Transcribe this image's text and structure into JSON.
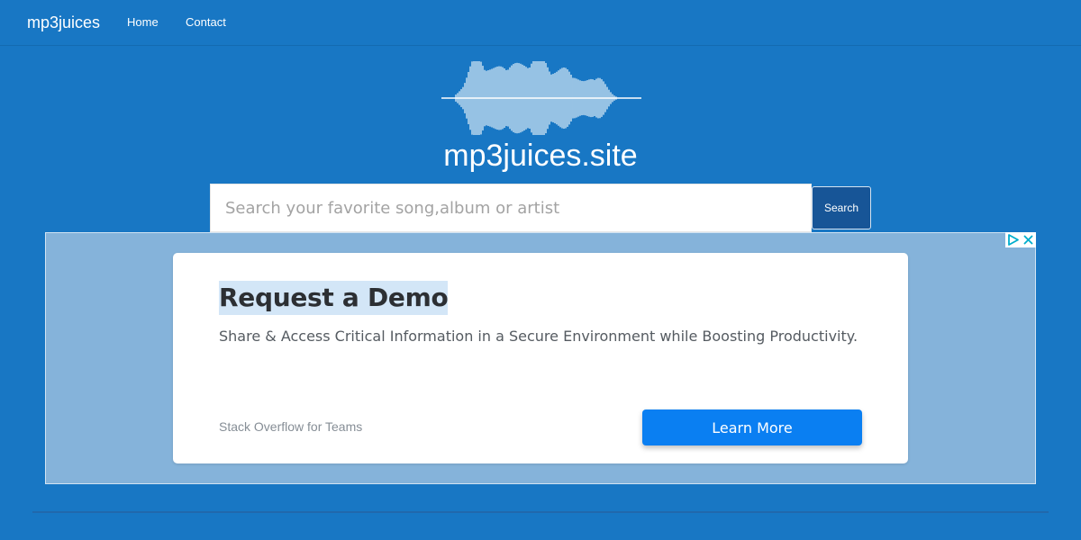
{
  "navbar": {
    "brand": "mp3juices",
    "links": [
      "Home",
      "Contact"
    ]
  },
  "hero": {
    "logo_icon": "sound-waveform-icon",
    "site_title": "mp3juices.site"
  },
  "search": {
    "placeholder": "Search your favorite song,album or artist",
    "value": "",
    "button_label": "Search"
  },
  "ad": {
    "headline": "Request a Demo",
    "description": "Share & Access Critical Information in a Secure Environment while Boosting Productivity.",
    "advertiser": "Stack Overflow for Teams",
    "cta_label": "Learn More",
    "adchoices_icon": "adchoices-icon",
    "close_icon": "close-icon"
  },
  "colors": {
    "page_background": "#1877c4",
    "search_button": "#175597",
    "ad_background": "#85b3da",
    "cta_button": "#0a7ff2",
    "headline_highlight": "#d3e6f7"
  }
}
